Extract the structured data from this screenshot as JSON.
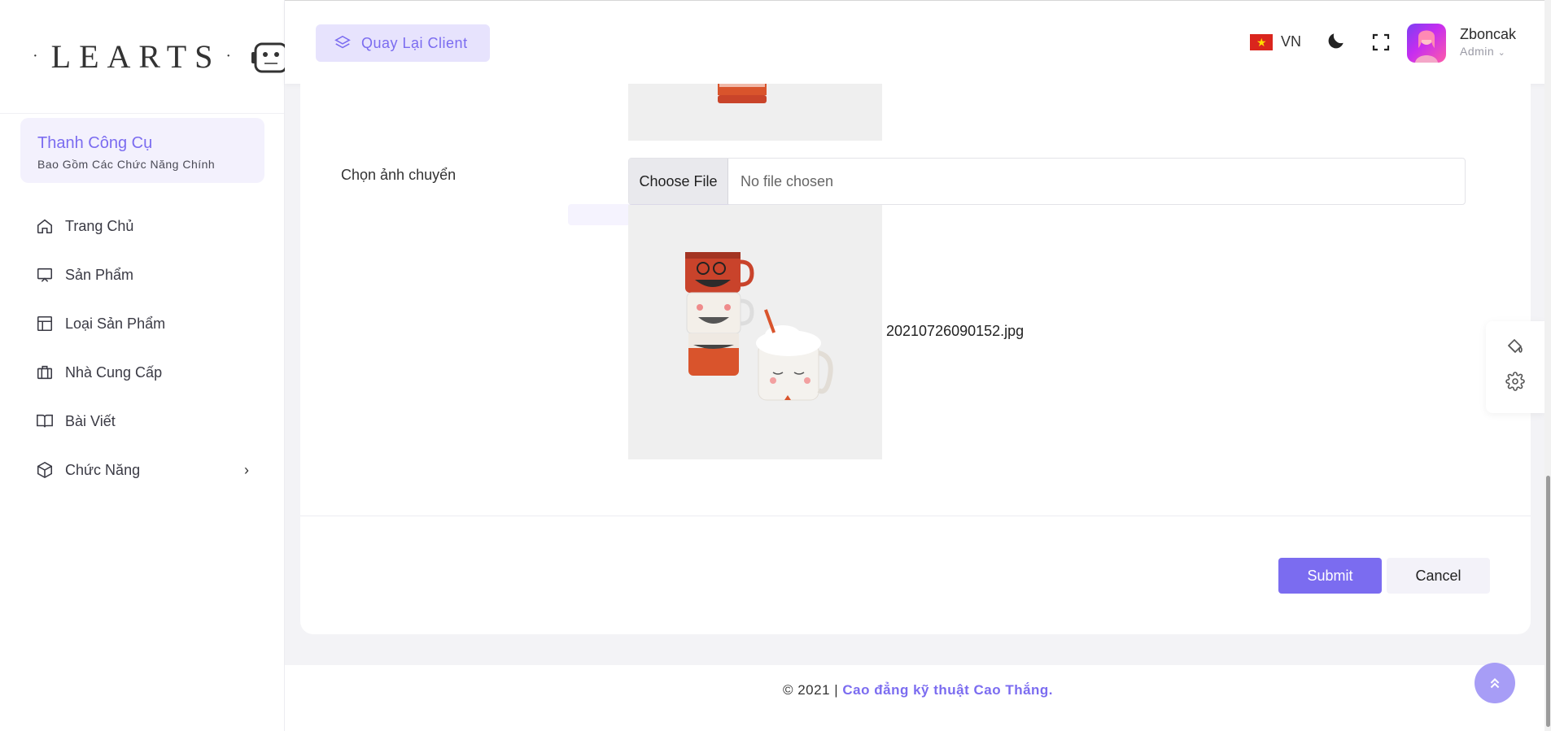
{
  "brand": {
    "logo_text": "LEARTS"
  },
  "sidebar": {
    "toolbox_title": "Thanh Công Cụ",
    "toolbox_subtitle": "Bao Gồm Các Chức Năng Chính",
    "items": [
      {
        "label": "Trang Chủ",
        "icon": "home-icon"
      },
      {
        "label": "Sản Phẩm",
        "icon": "monitor-icon"
      },
      {
        "label": "Loại Sản Phẩm",
        "icon": "layout-icon"
      },
      {
        "label": "Nhà Cung Cấp",
        "icon": "briefcase-icon"
      },
      {
        "label": "Bài Viết",
        "icon": "book-icon"
      },
      {
        "label": "Chức Năng",
        "icon": "box-icon",
        "has_submenu": true
      }
    ]
  },
  "header": {
    "back_button": "Quay Lại Client",
    "language": "VN",
    "user": {
      "name": "Zboncak",
      "role": "Admin"
    }
  },
  "form": {
    "field_label": "Chọn ảnh chuyển",
    "choose_file_label": "Choose File",
    "file_status": "No file chosen",
    "image_filename": "20210726090152.jpg",
    "submit_label": "Submit",
    "cancel_label": "Cancel"
  },
  "footer": {
    "copyright": "© 2021 |",
    "link_text": "Cao đẳng kỹ thuật Cao Thắng."
  },
  "colors": {
    "accent": "#7b6cf0",
    "accent_light": "#e7e3fd",
    "background": "#f3f3f6"
  }
}
